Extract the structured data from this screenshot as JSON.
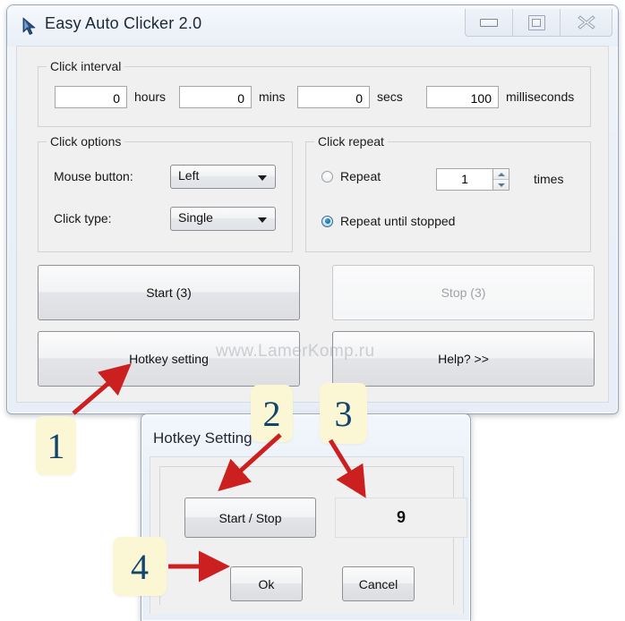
{
  "window": {
    "title": "Easy Auto Clicker 2.0",
    "icon": "cursor-arrow-icon",
    "caption_buttons": [
      {
        "name": "minimize",
        "glyph": "minimize-icon"
      },
      {
        "name": "maximize",
        "glyph": "maximize-icon"
      },
      {
        "name": "close",
        "glyph": "close-icon"
      }
    ]
  },
  "click_interval": {
    "group_label": "Click interval",
    "fields": [
      {
        "value": "0",
        "unit": "hours"
      },
      {
        "value": "0",
        "unit": "mins"
      },
      {
        "value": "0",
        "unit": "secs"
      },
      {
        "value": "100",
        "unit": "milliseconds"
      }
    ]
  },
  "click_options": {
    "group_label": "Click options",
    "mouse_button_label": "Mouse button:",
    "mouse_button_value": "Left",
    "click_type_label": "Click type:",
    "click_type_value": "Single"
  },
  "click_repeat": {
    "group_label": "Click repeat",
    "repeat_label": "Repeat",
    "repeat_checked": false,
    "repeat_count": "1",
    "times_label": "times",
    "repeat_until_stopped_label": "Repeat until stopped",
    "repeat_until_stopped_checked": true
  },
  "buttons": {
    "start": "Start (3)",
    "stop": "Stop (3)",
    "hotkey": "Hotkey setting",
    "help": "Help? >>"
  },
  "watermark": "www.LamerKomp.ru",
  "dialog": {
    "title": "Hotkey Setting",
    "start_stop": "Start / Stop",
    "key_value": "9",
    "ok": "Ok",
    "cancel": "Cancel"
  },
  "callouts": [
    {
      "number": "1"
    },
    {
      "number": "2"
    },
    {
      "number": "3"
    },
    {
      "number": "4"
    }
  ],
  "colors": {
    "callout_bg": "#fbf6d3",
    "callout_text": "#11456d",
    "arrow": "#cc2020",
    "radio_selected": "#1368a0"
  }
}
